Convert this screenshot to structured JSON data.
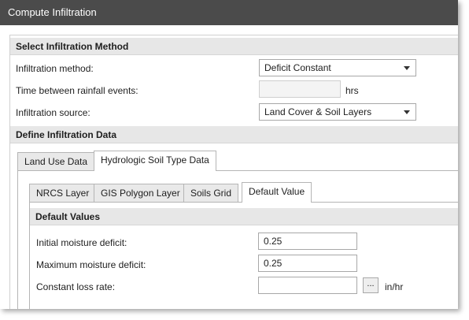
{
  "window": {
    "title": "Compute Infiltration"
  },
  "method_section": {
    "header": "Select Infiltration Method",
    "method_label": "Infiltration method:",
    "method_value": "Deficit Constant",
    "time_label": "Time between rainfall events:",
    "time_value": "",
    "time_unit": "hrs",
    "source_label": "Infiltration source:",
    "source_value": "Land Cover & Soil Layers"
  },
  "data_section": {
    "header": "Define Infiltration Data",
    "outer_tabs": [
      {
        "label": "Land Use Data",
        "active": false
      },
      {
        "label": "Hydrologic Soil Type Data",
        "active": true
      }
    ],
    "inner_tabs": [
      {
        "label": "NRCS Layer",
        "active": false
      },
      {
        "label": "GIS Polygon Layer",
        "active": false
      },
      {
        "label": "Soils Grid",
        "active": false
      },
      {
        "label": "Default Value",
        "active": true
      }
    ],
    "default_values": {
      "header": "Default Values",
      "initial_label": "Initial moisture deficit:",
      "initial_value": "0.25",
      "max_label": "Maximum moisture deficit:",
      "max_value": "0.25",
      "loss_label": "Constant loss rate:",
      "loss_value": "",
      "loss_button": "...",
      "loss_unit": "in/hr"
    }
  }
}
